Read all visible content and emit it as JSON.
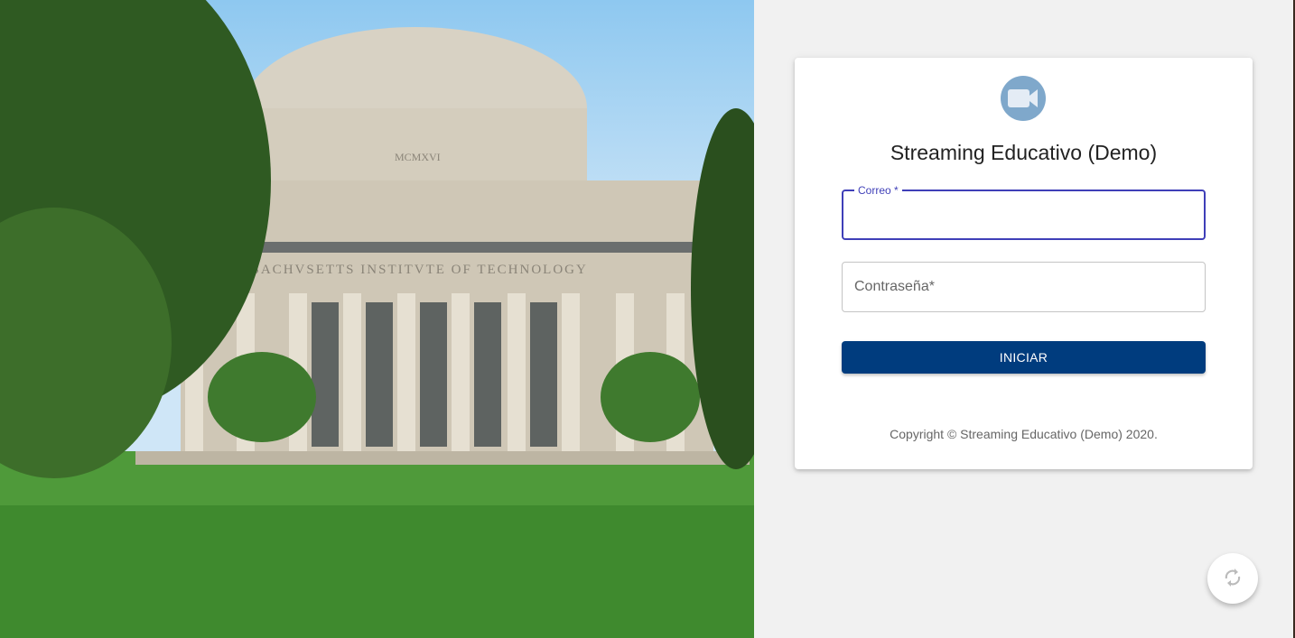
{
  "login": {
    "title": "Streaming Educativo (Demo)",
    "logo_icon": "video-camera-icon",
    "email": {
      "label": "Correo",
      "required_mark": "*",
      "value": ""
    },
    "password": {
      "label": "Contraseña",
      "required_mark": "*",
      "value": ""
    },
    "submit_label": "INICIAR",
    "copyright": "Copyright © Streaming Educativo (Demo) 2020."
  },
  "photo": {
    "inscription": "MASSACHVSETTS INSTITVTE OF TECHNOLOGY",
    "dome_inscription": "MCMXVI"
  },
  "fab": {
    "icon": "refresh-icon"
  },
  "colors": {
    "primary": "#003c7e",
    "focus": "#3f3fb8",
    "logo": "#7fa8cb"
  }
}
